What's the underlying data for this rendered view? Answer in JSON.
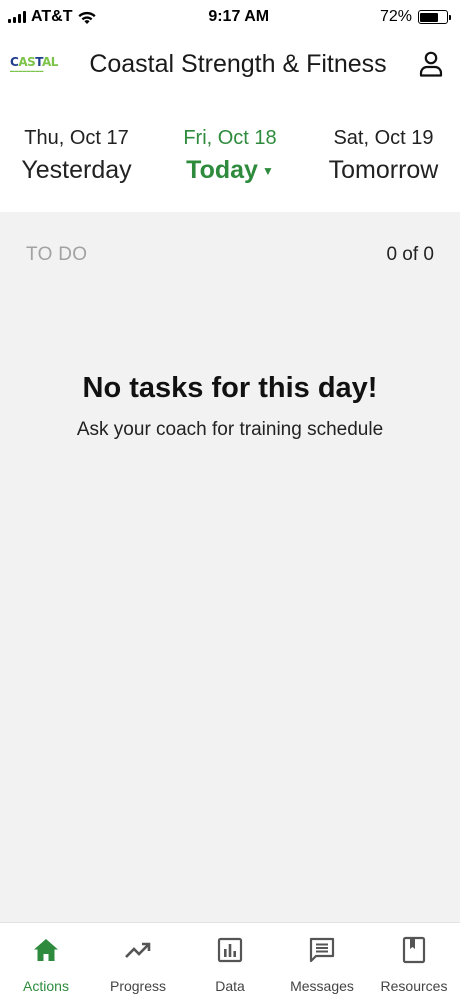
{
  "status_bar": {
    "carrier": "AT&T",
    "time": "9:17 AM",
    "battery_percent": "72%",
    "battery_level": 0.72
  },
  "header": {
    "logo_text_a": "C",
    "logo_text_b": "AS",
    "logo_text_c": "T",
    "logo_text_d": "AL",
    "title": "Coastal Strength & Fitness",
    "profile_icon": "user-icon"
  },
  "dates": [
    {
      "date": "Thu, Oct 17",
      "label": "Yesterday"
    },
    {
      "date": "Fri, Oct 18",
      "label": "Today"
    },
    {
      "date": "Sat, Oct 19",
      "label": "Tomorrow"
    }
  ],
  "todo": {
    "label": "TO DO",
    "count": "0 of 0"
  },
  "empty_state": {
    "title": "No tasks for this day!",
    "subtitle": "Ask your coach for training schedule"
  },
  "nav": [
    {
      "label": "Actions",
      "icon": "home-icon"
    },
    {
      "label": "Progress",
      "icon": "trending-up-icon"
    },
    {
      "label": "Data",
      "icon": "bar-chart-icon"
    },
    {
      "label": "Messages",
      "icon": "message-icon"
    },
    {
      "label": "Resources",
      "icon": "book-icon"
    }
  ],
  "colors": {
    "accent": "#2e8b3d",
    "background": "#f2f2f2"
  }
}
